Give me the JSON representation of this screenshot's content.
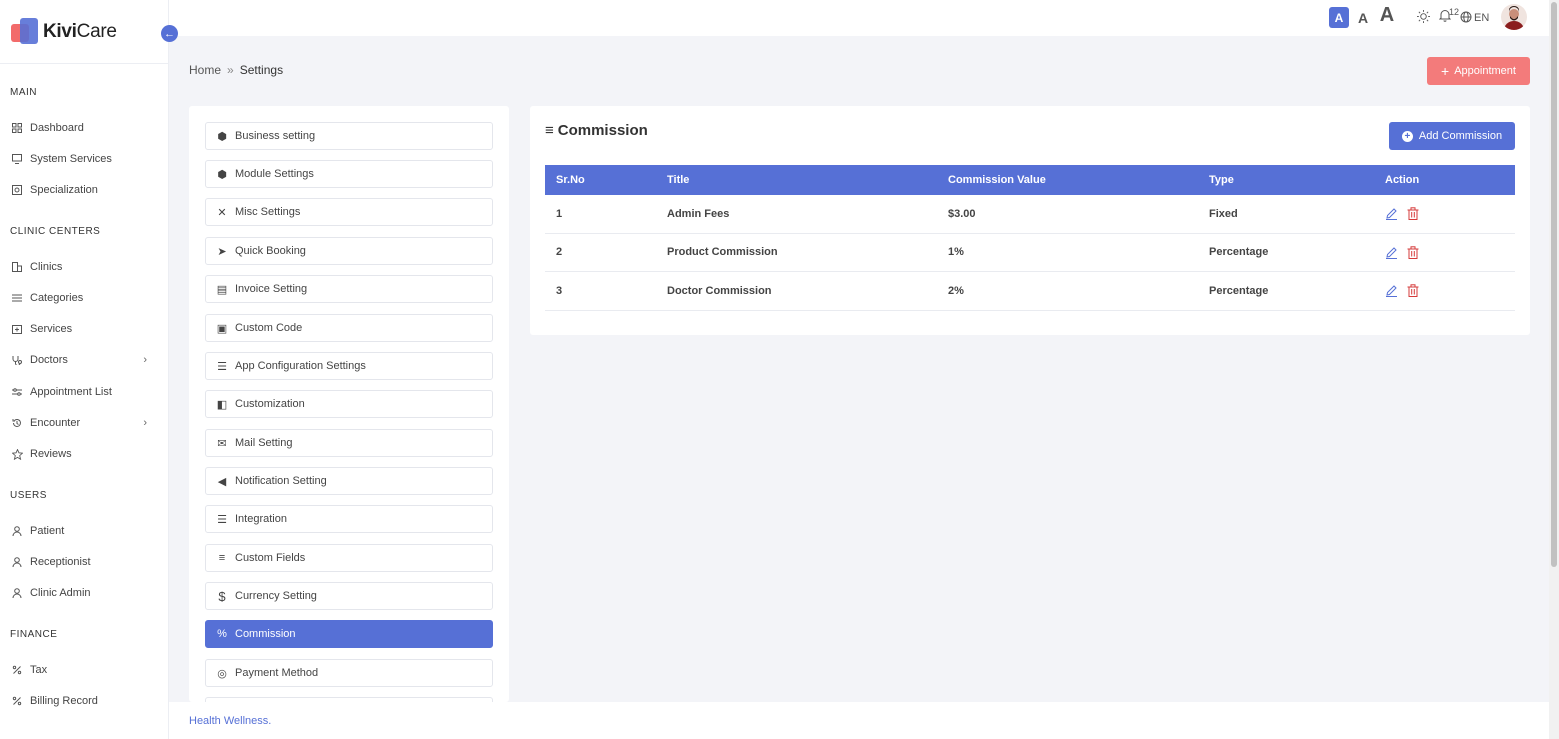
{
  "brand": {
    "name_bold": "Kivi",
    "name_regular": "Care"
  },
  "sidebar": {
    "sections": [
      {
        "title": "MAIN",
        "items": [
          {
            "label": "Dashboard",
            "icon": "grid-icon"
          },
          {
            "label": "System Services",
            "icon": "monitor-icon"
          },
          {
            "label": "Specialization",
            "icon": "badge-icon"
          }
        ]
      },
      {
        "title": "CLINIC CENTERS",
        "items": [
          {
            "label": "Clinics",
            "icon": "building-icon"
          },
          {
            "label": "Categories",
            "icon": "list-icon"
          },
          {
            "label": "Services",
            "icon": "plus-square-icon"
          },
          {
            "label": "Doctors",
            "icon": "stethoscope-icon",
            "chevron": true
          },
          {
            "label": "Appointment List",
            "icon": "sliders-icon"
          },
          {
            "label": "Encounter",
            "icon": "history-icon",
            "chevron": true
          },
          {
            "label": "Reviews",
            "icon": "star-icon"
          }
        ]
      },
      {
        "title": "USERS",
        "items": [
          {
            "label": "Patient",
            "icon": "user-icon"
          },
          {
            "label": "Receptionist",
            "icon": "user-icon"
          },
          {
            "label": "Clinic Admin",
            "icon": "user-icon"
          }
        ]
      },
      {
        "title": "FINANCE",
        "items": [
          {
            "label": "Tax",
            "icon": "percent-icon"
          },
          {
            "label": "Billing Record",
            "icon": "percent-icon"
          }
        ]
      }
    ]
  },
  "header": {
    "font_sizes": [
      "A",
      "A",
      "A"
    ],
    "notification_count": "12",
    "language": "EN"
  },
  "breadcrumb": {
    "home": "Home",
    "current": "Settings"
  },
  "appointment_button": {
    "label": "Appointment"
  },
  "settings_menu": [
    {
      "label": "Business setting",
      "icon": "cube-icon"
    },
    {
      "label": "Module Settings",
      "icon": "cube-icon"
    },
    {
      "label": "Misc Settings",
      "icon": "tools-icon"
    },
    {
      "label": "Quick Booking",
      "icon": "paper-plane-icon"
    },
    {
      "label": "Invoice Setting",
      "icon": "file-icon"
    },
    {
      "label": "Custom Code",
      "icon": "file-code-icon"
    },
    {
      "label": "App Configuration Settings",
      "icon": "sliders-icon"
    },
    {
      "label": "Customization",
      "icon": "palette-icon"
    },
    {
      "label": "Mail Setting",
      "icon": "envelope-icon"
    },
    {
      "label": "Notification Setting",
      "icon": "megaphone-icon"
    },
    {
      "label": "Integration",
      "icon": "sliders-icon"
    },
    {
      "label": "Custom Fields",
      "icon": "bars-icon"
    },
    {
      "label": "Currency Setting",
      "icon": "dollar-icon"
    },
    {
      "label": "Commission",
      "icon": "percent-icon",
      "active": true
    },
    {
      "label": "Payment Method",
      "icon": "coins-icon"
    }
  ],
  "commission": {
    "title": "Commission",
    "add_button": "Add Commission",
    "columns": [
      "Sr.No",
      "Title",
      "Commission Value",
      "Type",
      "Action"
    ],
    "rows": [
      {
        "sr": "1",
        "title": "Admin Fees",
        "value": "$3.00",
        "type": "Fixed"
      },
      {
        "sr": "2",
        "title": "Product Commission",
        "value": "1%",
        "type": "Percentage"
      },
      {
        "sr": "3",
        "title": "Doctor Commission",
        "value": "2%",
        "type": "Percentage"
      }
    ]
  },
  "footer": {
    "text": "Health Wellness."
  },
  "colors": {
    "primary": "#5670d6",
    "danger": "#f37b7b",
    "delete": "#d63b3b"
  }
}
